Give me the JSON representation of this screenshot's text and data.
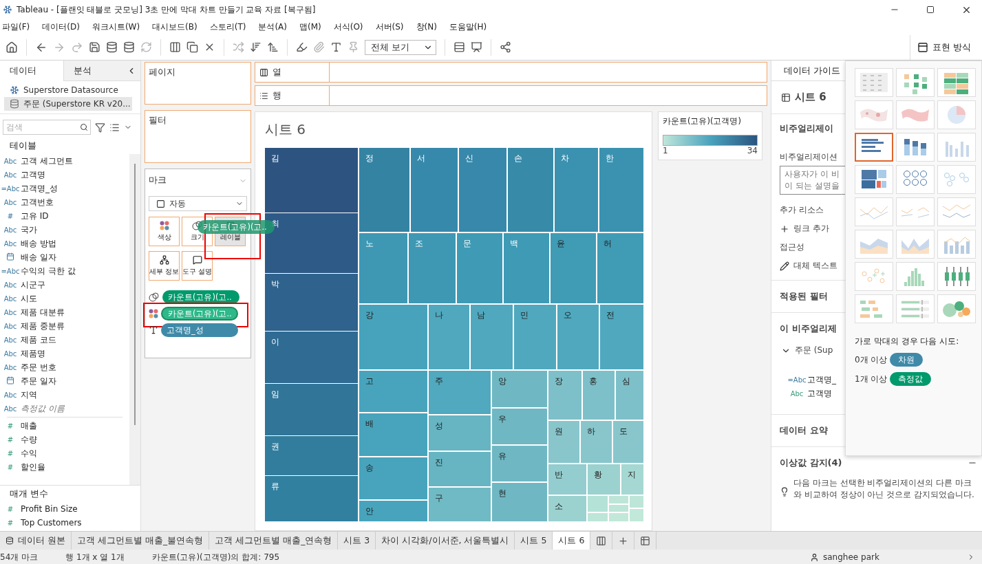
{
  "window": {
    "title": "Tableau - [플랜잇 태블로 굿모닝] 3초 만에 막대 차트 만들기 교육 자료 [복구됨]"
  },
  "menu": [
    "파일(F)",
    "데이터(D)",
    "워크시트(W)",
    "대시보드(B)",
    "스토리(T)",
    "분석(A)",
    "맵(M)",
    "서식(O)",
    "서버(S)",
    "창(N)",
    "도움말(H)"
  ],
  "toolbar": {
    "view_select": "전체 보기",
    "show_me": {
      "label": "표현 방식",
      "selected": true
    }
  },
  "data_pane": {
    "tabs": [
      {
        "label": "데이터",
        "selected": true
      },
      {
        "label": "분석",
        "selected": false
      }
    ],
    "sources": [
      {
        "name": "Superstore Datasource",
        "selected": false
      },
      {
        "name": "주문 (Superstore KR v20...",
        "selected": true
      }
    ],
    "search": {
      "placeholder": "검색"
    },
    "tables_heading": "테이블",
    "fields": [
      {
        "kind": "dim",
        "badge": "Abc",
        "name": "고객 세그먼트"
      },
      {
        "kind": "dim",
        "badge": "Abc",
        "name": "고객명"
      },
      {
        "kind": "dim",
        "badge": "=Abc",
        "name": "고객명_성"
      },
      {
        "kind": "dim",
        "badge": "Abc",
        "name": "고객번호"
      },
      {
        "kind": "dim",
        "badge": "#",
        "name": "고유 ID"
      },
      {
        "kind": "dim",
        "badge": "Abc",
        "name": "국가"
      },
      {
        "kind": "dim",
        "badge": "Abc",
        "name": "배송 방법"
      },
      {
        "kind": "date",
        "name": "배송 일자"
      },
      {
        "kind": "dim",
        "badge": "=Abc",
        "name": "수익의 극한 값"
      },
      {
        "kind": "dim",
        "badge": "Abc",
        "name": "시군구"
      },
      {
        "kind": "dim",
        "badge": "Abc",
        "name": "시도"
      },
      {
        "kind": "dim",
        "badge": "Abc",
        "name": "제품 대분류"
      },
      {
        "kind": "dim",
        "badge": "Abc",
        "name": "제품 중분류"
      },
      {
        "kind": "dim",
        "badge": "Abc",
        "name": "제품 코드"
      },
      {
        "kind": "dim",
        "badge": "Abc",
        "name": "제품명"
      },
      {
        "kind": "dim",
        "badge": "Abc",
        "name": "주문 번호"
      },
      {
        "kind": "date",
        "name": "주문 일자"
      },
      {
        "kind": "dim",
        "badge": "Abc",
        "name": "지역"
      },
      {
        "kind": "names",
        "badge": "Abc",
        "name": "측정값 이름"
      },
      {
        "kind": "measure",
        "badge": "#",
        "name": "매출"
      },
      {
        "kind": "measure",
        "badge": "#",
        "name": "수량"
      },
      {
        "kind": "measure",
        "badge": "#",
        "name": "수익"
      },
      {
        "kind": "measure",
        "badge": "#",
        "name": "할인율"
      }
    ],
    "params_heading": "매개 변수",
    "parameters": [
      {
        "kind": "measure",
        "badge": "#",
        "name": "Profit Bin Size"
      },
      {
        "kind": "measure",
        "badge": "#",
        "name": "Top Customers"
      }
    ]
  },
  "shelves": {
    "pages": "페이지",
    "filters": "필터",
    "columns": "열",
    "rows": "행"
  },
  "marks": {
    "title": "마크",
    "mark_type": "자동",
    "cards": [
      {
        "kind": "color",
        "label": "색상",
        "selected": false,
        "framed": false
      },
      {
        "kind": "size",
        "label": "크기",
        "selected": false,
        "framed": false
      },
      {
        "kind": "label",
        "label": "레이블",
        "selected": true,
        "framed": true
      },
      {
        "kind": "detail",
        "label": "세부 정보",
        "selected": false,
        "framed": false
      },
      {
        "kind": "tooltip",
        "label": "도구 설명",
        "selected": false,
        "framed": false
      }
    ],
    "pills": [
      {
        "kind": "size",
        "measure": true,
        "text": "카운트(고유)(고..",
        "dragging": false,
        "framed": false
      },
      {
        "kind": "color",
        "measure": true,
        "text": "카운트(고유)(고..",
        "dragging": true,
        "framed": true
      },
      {
        "kind": "label",
        "measure": false,
        "text": "고객명_성",
        "dragging": false,
        "framed": false
      }
    ],
    "drag_pill": "카운트(고유)(고.."
  },
  "sheet": {
    "title": "시트 6",
    "treemap": {
      "cells": [
        {
          "label": "김",
          "color": "#2d5481"
        },
        {
          "label": "최",
          "color": "#2e5a87"
        },
        {
          "label": "박",
          "color": "#2f628d"
        },
        {
          "label": "이",
          "color": "#2f6b93"
        },
        {
          "label": "임",
          "color": "#317598"
        },
        {
          "label": "권",
          "color": "#327d9d"
        },
        {
          "label": "류",
          "color": "#32809f"
        },
        {
          "label": "정",
          "color": "#3583a3"
        },
        {
          "label": "서",
          "color": "#3789ab"
        },
        {
          "label": "신",
          "color": "#3788aa"
        },
        {
          "label": "손",
          "color": "#388aa9"
        },
        {
          "label": "차",
          "color": "#3a91b0"
        },
        {
          "label": "한",
          "color": "#3a92b0"
        },
        {
          "label": "노",
          "color": "#3e98b4"
        },
        {
          "label": "조",
          "color": "#3e98b4"
        },
        {
          "label": "문",
          "color": "#3f9ab5"
        },
        {
          "label": "백",
          "color": "#3f9ab5"
        },
        {
          "label": "윤",
          "color": "#409bb5"
        },
        {
          "label": "허",
          "color": "#409bb5"
        },
        {
          "label": "강",
          "color": "#47a3bb"
        },
        {
          "label": "고",
          "color": "#48a4bc"
        },
        {
          "label": "배",
          "color": "#48a4bc"
        },
        {
          "label": "송",
          "color": "#48a4bc"
        },
        {
          "label": "안",
          "color": "#48a4bc"
        },
        {
          "label": "나",
          "color": "#4fa8be"
        },
        {
          "label": "남",
          "color": "#4fa8be"
        },
        {
          "label": "민",
          "color": "#4fa8be"
        },
        {
          "label": "오",
          "color": "#4fa8be"
        },
        {
          "label": "전",
          "color": "#4fa8be"
        },
        {
          "label": "주",
          "color": "#50a9be"
        },
        {
          "label": "성",
          "color": "#67b5c3"
        },
        {
          "label": "진",
          "color": "#67b5c3"
        },
        {
          "label": "구",
          "color": "#6fbac4"
        },
        {
          "label": "앙",
          "color": "#6fb8c3"
        },
        {
          "label": "우",
          "color": "#6fb8c3"
        },
        {
          "label": "유",
          "color": "#6fb8c3"
        },
        {
          "label": "현",
          "color": "#6fb8c3"
        },
        {
          "label": "장",
          "color": "#7ec0c9"
        },
        {
          "label": "홍",
          "color": "#7ec0c9"
        },
        {
          "label": "심",
          "color": "#7ec0c9"
        },
        {
          "label": "원",
          "color": "#88c6cc"
        },
        {
          "label": "하",
          "color": "#88c6cc"
        },
        {
          "label": "도",
          "color": "#88c6cc"
        },
        {
          "label": "반",
          "color": "#93cdcf"
        },
        {
          "label": "황",
          "color": "#9bd2d0"
        },
        {
          "label": "지",
          "color": "#a5d8d2"
        },
        {
          "label": "소",
          "color": "#9bd2d0"
        },
        {
          "color": "#b5e2d6"
        },
        {
          "color": "#bde5d8"
        },
        {
          "color": "#bde5d8"
        },
        {
          "color": "#bde5d8"
        },
        {
          "color": "#bde5d8"
        },
        {
          "color": "#c2e8da"
        },
        {
          "color": "#c2e8da"
        }
      ]
    }
  },
  "legend": {
    "title": "카운트(고유)(고객명)",
    "min": "1",
    "max": "34"
  },
  "data_guide": {
    "tab": "데이터 가이드",
    "sheet": "시트 6",
    "viz_heading": "비주얼리제이",
    "desc_label": "비주얼리제이션",
    "desc_placeholder": [
      "사용자가 이 비",
      "이 되는 설명을"
    ],
    "resources": "추가 리소스",
    "add_link": "링크 추가",
    "accessibility": "접근성",
    "alt_text": "대체 텍스트",
    "filters": "적용된 필터",
    "fields_heading": "이 비주얼리제",
    "source": "주문 (Sup",
    "fields": [
      {
        "kind": "dim",
        "badge": "=Abc",
        "name": "고객명_"
      },
      {
        "kind": "measure",
        "badge": "Abc",
        "name": "고객명"
      }
    ],
    "summary": "데이터 요약",
    "outliers": {
      "title": "이상값 감지(4)",
      "expanded": true,
      "text": "다음 마크는 선택한 비주얼리제이션의 다른 마크와 비교하여 정상이 아닌 것으로 감지되었습니다."
    }
  },
  "show_me": {
    "thumbnails": [
      {
        "kind": "text_table",
        "selected": false
      },
      {
        "kind": "heat_map",
        "selected": false
      },
      {
        "kind": "highlight_table",
        "selected": false
      },
      {
        "kind": "symbol_map",
        "selected": false
      },
      {
        "kind": "filled_map",
        "selected": false
      },
      {
        "kind": "pie",
        "selected": false
      },
      {
        "kind": "hbar",
        "selected": true
      },
      {
        "kind": "stacked_bar",
        "selected": false
      },
      {
        "kind": "side_bar",
        "selected": false
      },
      {
        "kind": "treemap",
        "selected": false
      },
      {
        "kind": "circles",
        "selected": false
      },
      {
        "kind": "side_circles",
        "selected": false
      },
      {
        "kind": "line",
        "selected": false
      },
      {
        "kind": "line_split",
        "selected": false
      },
      {
        "kind": "dual_line",
        "selected": false
      },
      {
        "kind": "area",
        "selected": false
      },
      {
        "kind": "area_split",
        "selected": false
      },
      {
        "kind": "combo",
        "selected": false
      },
      {
        "kind": "scatter",
        "selected": false
      },
      {
        "kind": "histogram",
        "selected": false
      },
      {
        "kind": "box_plot",
        "selected": false
      },
      {
        "kind": "gantt",
        "selected": false
      },
      {
        "kind": "bullet",
        "selected": false
      },
      {
        "kind": "bubbles",
        "selected": false
      }
    ],
    "hint": "가로 막대의 경우 다음 시도:",
    "requirements": [
      {
        "count": "0개 이상",
        "pill": "차원",
        "kind": "dimension"
      },
      {
        "count": "1개 이상",
        "pill": "측정값",
        "kind": "measure"
      }
    ]
  },
  "sheet_tabs": [
    {
      "kind": "source",
      "label": "데이터 원본",
      "selected": false
    },
    {
      "kind": "sheet",
      "label": "고객 세그먼트별 매출_불연속형",
      "selected": false
    },
    {
      "kind": "sheet",
      "label": "고객 세그먼트별 매출_연속형",
      "selected": false
    },
    {
      "kind": "sheet",
      "label": "시트 3",
      "selected": false
    },
    {
      "kind": "sheet",
      "label": "차이 시각화/이서준, 서울특별시",
      "selected": false
    },
    {
      "kind": "sheet",
      "label": "시트 5",
      "selected": false
    },
    {
      "kind": "sheet",
      "label": "시트 6",
      "selected": true
    }
  ],
  "status": {
    "marks": "54개 마크",
    "dims": "행 1개 x 열 1개",
    "sum": "카운트(고유)(고객명)의 합계: 795",
    "user": "sanghee park"
  }
}
